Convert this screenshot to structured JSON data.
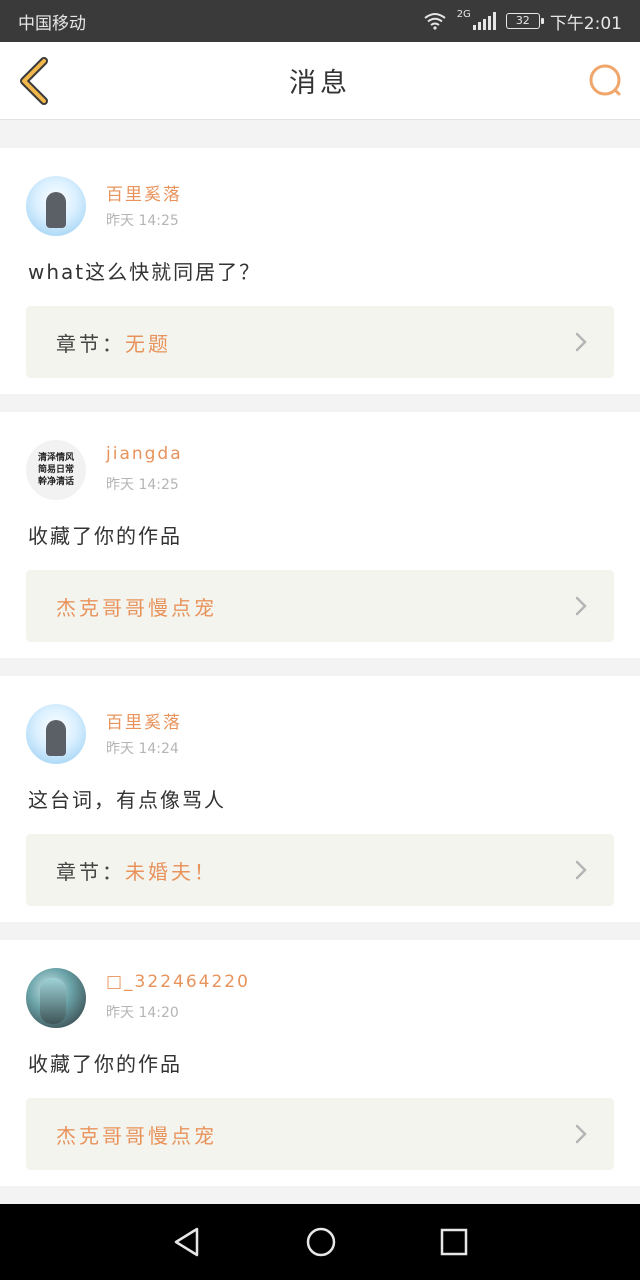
{
  "status_bar": {
    "carrier": "中国移动",
    "network": "2G",
    "battery": "32",
    "time": "下午2:01"
  },
  "header": {
    "title": "消息",
    "back_icon": "chevron-left-icon",
    "search_icon": "search-icon",
    "accent_color": "#e8935c"
  },
  "messages": [
    {
      "username": "百里奚落",
      "time": "昨天 14:25",
      "content": "what这么快就同居了？",
      "ref_prefix": "章节：",
      "ref_name": "无题"
    },
    {
      "username": "jiangda",
      "time": "昨天 14:25",
      "content": "收藏了你的作品",
      "ref_prefix": "",
      "ref_name": "杰克哥哥慢点宠",
      "avatar_text": "清泽情风 简易日常 幹净清话"
    },
    {
      "username": "百里奚落",
      "time": "昨天 14:24",
      "content": "这台词，有点像骂人",
      "ref_prefix": "章节：",
      "ref_name": "未婚夫！"
    },
    {
      "username": "□_322464220",
      "time": "昨天 14:20",
      "content": "收藏了你的作品",
      "ref_prefix": "",
      "ref_name": "杰克哥哥慢点宠"
    }
  ],
  "nav_bar": {
    "back_icon": "triangle-back-icon",
    "home_icon": "circle-home-icon",
    "recent_icon": "square-recent-icon"
  }
}
